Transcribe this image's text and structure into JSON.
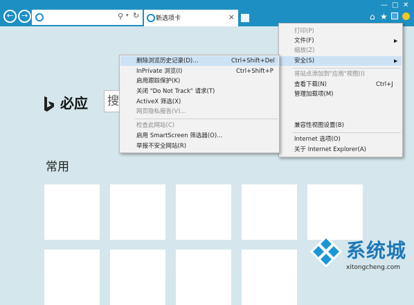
{
  "tab": {
    "label": "新选项卡"
  },
  "address": {
    "placeholder": ""
  },
  "bing": {
    "name": "必应",
    "search_glyph": "搜"
  },
  "common": {
    "label": "常用"
  },
  "tools_menu": {
    "items": [
      {
        "label": "打印(P)",
        "disabled": true
      },
      {
        "label": "文件(F)",
        "submenu": true
      },
      {
        "label": "缩放(Z)",
        "disabled": true
      },
      {
        "label": "安全(S)",
        "submenu": true,
        "highlighted": true
      },
      {
        "label": "将站点添加到\"应用\"视图(I)",
        "disabled": true
      },
      {
        "label": "查看下载(N)",
        "shortcut": "Ctrl+J"
      },
      {
        "label": "管理加载项(M)"
      },
      {
        "label": "兼容性视图设置(B)"
      },
      {
        "label": "Internet 选项(O)"
      },
      {
        "label": "关于 Internet Explorer(A)"
      }
    ]
  },
  "safety_menu": {
    "items": [
      {
        "label": "删除浏览历史记录(D)...",
        "shortcut": "Ctrl+Shift+Del",
        "highlighted": true
      },
      {
        "label": "InPrivate 浏览(I)",
        "shortcut": "Ctrl+Shift+P"
      },
      {
        "label": "启用跟踪保护(K)"
      },
      {
        "label": "关闭 \"Do Not Track\" 请求(T)"
      },
      {
        "label": "ActiveX 筛选(X)"
      },
      {
        "label": "网页隐私报告(V)...",
        "disabled": true
      },
      {
        "label": "检查此网站(C)",
        "disabled": true
      },
      {
        "label": "启用 SmartScreen 筛选器(O)..."
      },
      {
        "label": "举报不安全网站(R)"
      }
    ]
  },
  "watermark": {
    "brand": "系统城",
    "url": "xitongcheng.com"
  },
  "colors": {
    "titlebar": "#1e8fc2",
    "background": "#d5e7ec",
    "menu_highlight": "#cde3f5",
    "watermark": "#1d78b8"
  }
}
